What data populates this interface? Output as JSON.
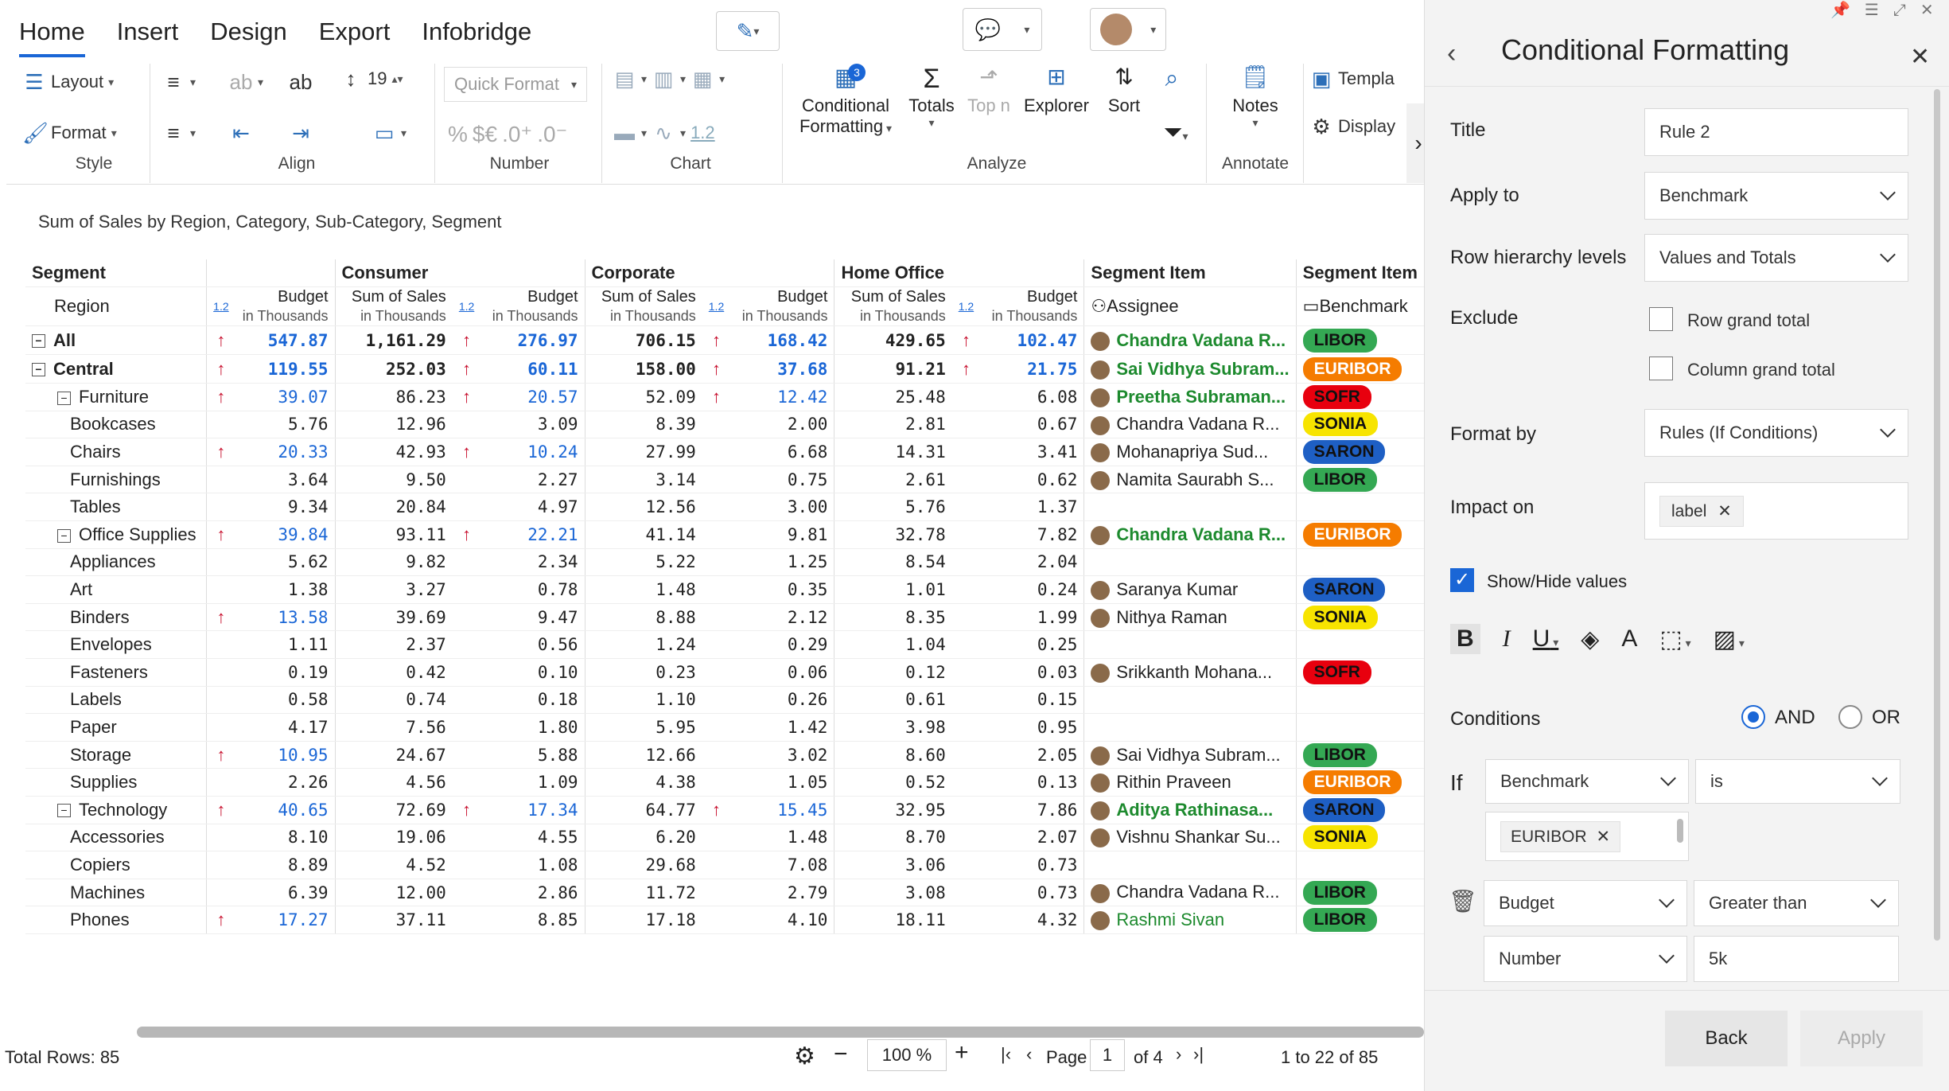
{
  "tabs": [
    "Home",
    "Insert",
    "Design",
    "Export",
    "Infobridge"
  ],
  "ribbon": {
    "layout": "Layout",
    "format": "Format",
    "style": "Style",
    "align": "Align",
    "font_size": "19",
    "quick_format": "Quick Format",
    "number": "Number",
    "number_sym_pct": "%",
    "number_sym_cur": "$€",
    "chart": "Chart",
    "chart_num": "1.2",
    "conditional": "Conditional",
    "formatting": "Formatting",
    "cond_count": "3",
    "totals": "Totals",
    "topn": "Top n",
    "explorer": "Explorer",
    "sort": "Sort",
    "analyze": "Analyze",
    "notes": "Notes",
    "annotate": "Annotate",
    "template": "Templa",
    "display": "Display"
  },
  "report_title": "Sum of Sales by Region, Category, Sub-Category, Segment",
  "headers": {
    "segment": "Segment",
    "region": "Region",
    "consumer": "Consumer",
    "corporate": "Corporate",
    "home_office": "Home Office",
    "segment_item": "Segment Item",
    "budget": "Budget",
    "sum_sales": "Sum of Sales",
    "in_thousands": "in Thousands",
    "assignee": "Assignee",
    "benchmark": "Benchmark",
    "num_icon": "1.2"
  },
  "rows": [
    {
      "label": "All",
      "level": 0,
      "exp": true,
      "bold": true,
      "a1": true,
      "c1": "547.87",
      "c2": "1,161.29",
      "a2": true,
      "c3": "276.97",
      "c4": "706.15",
      "a3": true,
      "c5": "168.42",
      "c6": "429.65",
      "a4": true,
      "c7": "102.47",
      "assignee": "Chandra Vadana R...",
      "astyle": "green",
      "pill": "LIBOR"
    },
    {
      "label": "Central",
      "level": 0,
      "exp": true,
      "bold": true,
      "a1": true,
      "c1": "119.55",
      "c2": "252.03",
      "a2": true,
      "c3": "60.11",
      "c4": "158.00",
      "a3": true,
      "c5": "37.68",
      "c6": "91.21",
      "a4": true,
      "c7": "21.75",
      "assignee": "Sai Vidhya Subram...",
      "astyle": "green",
      "pill": "EURIBOR"
    },
    {
      "label": "Furniture",
      "level": 1,
      "exp": true,
      "bold": false,
      "a1": true,
      "c1": "39.07",
      "c2": "86.23",
      "a2": true,
      "c3": "20.57",
      "c4": "52.09",
      "a3": true,
      "c5": "12.42",
      "c6": "25.48",
      "a4": false,
      "c7": "6.08",
      "assignee": "Preetha Subraman...",
      "astyle": "green",
      "pill": "SOFR"
    },
    {
      "label": "Bookcases",
      "level": 2,
      "a1": false,
      "c1": "5.76",
      "c2": "12.96",
      "a2": false,
      "c3": "3.09",
      "c4": "8.39",
      "a3": false,
      "c5": "2.00",
      "c6": "2.81",
      "a4": false,
      "c7": "0.67",
      "assignee": "Chandra Vadana R...",
      "astyle": "",
      "pill": "SONIA"
    },
    {
      "label": "Chairs",
      "level": 2,
      "a1": true,
      "c1": "20.33",
      "c2": "42.93",
      "a2": true,
      "c3": "10.24",
      "c4": "27.99",
      "a3": false,
      "c5": "6.68",
      "c6": "14.31",
      "a4": false,
      "c7": "3.41",
      "assignee": "Mohanapriya Sud...",
      "astyle": "",
      "pill": "SARON"
    },
    {
      "label": "Furnishings",
      "level": 2,
      "a1": false,
      "c1": "3.64",
      "c2": "9.50",
      "a2": false,
      "c3": "2.27",
      "c4": "3.14",
      "a3": false,
      "c5": "0.75",
      "c6": "2.61",
      "a4": false,
      "c7": "0.62",
      "assignee": "Namita Saurabh S...",
      "astyle": "",
      "pill": "LIBOR"
    },
    {
      "label": "Tables",
      "level": 2,
      "a1": false,
      "c1": "9.34",
      "c2": "20.84",
      "a2": false,
      "c3": "4.97",
      "c4": "12.56",
      "a3": false,
      "c5": "3.00",
      "c6": "5.76",
      "a4": false,
      "c7": "1.37",
      "assignee": "",
      "astyle": "",
      "pill": ""
    },
    {
      "label": "Office Supplies",
      "level": 1,
      "exp": true,
      "bold": false,
      "a1": true,
      "c1": "39.84",
      "c2": "93.11",
      "a2": true,
      "c3": "22.21",
      "c4": "41.14",
      "a3": false,
      "c5": "9.81",
      "c6": "32.78",
      "a4": false,
      "c7": "7.82",
      "assignee": "Chandra Vadana R...",
      "astyle": "green",
      "pill": "EURIBOR"
    },
    {
      "label": "Appliances",
      "level": 2,
      "a1": false,
      "c1": "5.62",
      "c2": "9.82",
      "a2": false,
      "c3": "2.34",
      "c4": "5.22",
      "a3": false,
      "c5": "1.25",
      "c6": "8.54",
      "a4": false,
      "c7": "2.04",
      "assignee": "",
      "astyle": "",
      "pill": ""
    },
    {
      "label": "Art",
      "level": 2,
      "a1": false,
      "c1": "1.38",
      "c2": "3.27",
      "a2": false,
      "c3": "0.78",
      "c4": "1.48",
      "a3": false,
      "c5": "0.35",
      "c6": "1.01",
      "a4": false,
      "c7": "0.24",
      "assignee": "Saranya Kumar",
      "astyle": "",
      "pill": "SARON"
    },
    {
      "label": "Binders",
      "level": 2,
      "a1": true,
      "c1": "13.58",
      "c2": "39.69",
      "a2": false,
      "c3": "9.47",
      "c4": "8.88",
      "a3": false,
      "c5": "2.12",
      "c6": "8.35",
      "a4": false,
      "c7": "1.99",
      "assignee": "Nithya Raman",
      "astyle": "",
      "pill": "SONIA"
    },
    {
      "label": "Envelopes",
      "level": 2,
      "a1": false,
      "c1": "1.11",
      "c2": "2.37",
      "a2": false,
      "c3": "0.56",
      "c4": "1.24",
      "a3": false,
      "c5": "0.29",
      "c6": "1.04",
      "a4": false,
      "c7": "0.25",
      "assignee": "",
      "astyle": "",
      "pill": ""
    },
    {
      "label": "Fasteners",
      "level": 2,
      "a1": false,
      "c1": "0.19",
      "c2": "0.42",
      "a2": false,
      "c3": "0.10",
      "c4": "0.23",
      "a3": false,
      "c5": "0.06",
      "c6": "0.12",
      "a4": false,
      "c7": "0.03",
      "assignee": "Srikkanth Mohana...",
      "astyle": "",
      "pill": "SOFR"
    },
    {
      "label": "Labels",
      "level": 2,
      "a1": false,
      "c1": "0.58",
      "c2": "0.74",
      "a2": false,
      "c3": "0.18",
      "c4": "1.10",
      "a3": false,
      "c5": "0.26",
      "c6": "0.61",
      "a4": false,
      "c7": "0.15",
      "assignee": "",
      "astyle": "",
      "pill": ""
    },
    {
      "label": "Paper",
      "level": 2,
      "a1": false,
      "c1": "4.17",
      "c2": "7.56",
      "a2": false,
      "c3": "1.80",
      "c4": "5.95",
      "a3": false,
      "c5": "1.42",
      "c6": "3.98",
      "a4": false,
      "c7": "0.95",
      "assignee": "",
      "astyle": "",
      "pill": ""
    },
    {
      "label": "Storage",
      "level": 2,
      "a1": true,
      "c1": "10.95",
      "c2": "24.67",
      "a2": false,
      "c3": "5.88",
      "c4": "12.66",
      "a3": false,
      "c5": "3.02",
      "c6": "8.60",
      "a4": false,
      "c7": "2.05",
      "assignee": "Sai Vidhya Subram...",
      "astyle": "",
      "pill": "LIBOR"
    },
    {
      "label": "Supplies",
      "level": 2,
      "a1": false,
      "c1": "2.26",
      "c2": "4.56",
      "a2": false,
      "c3": "1.09",
      "c4": "4.38",
      "a3": false,
      "c5": "1.05",
      "c6": "0.52",
      "a4": false,
      "c7": "0.13",
      "assignee": "Rithin Praveen",
      "astyle": "",
      "pill": "EURIBOR"
    },
    {
      "label": "Technology",
      "level": 1,
      "exp": true,
      "bold": false,
      "a1": true,
      "c1": "40.65",
      "c2": "72.69",
      "a2": true,
      "c3": "17.34",
      "c4": "64.77",
      "a3": true,
      "c5": "15.45",
      "c6": "32.95",
      "a4": false,
      "c7": "7.86",
      "assignee": "Aditya Rathinasa...",
      "astyle": "green",
      "pill": "SARON"
    },
    {
      "label": "Accessories",
      "level": 2,
      "a1": false,
      "c1": "8.10",
      "c2": "19.06",
      "a2": false,
      "c3": "4.55",
      "c4": "6.20",
      "a3": false,
      "c5": "1.48",
      "c6": "8.70",
      "a4": false,
      "c7": "2.07",
      "assignee": "Vishnu Shankar Su...",
      "astyle": "",
      "pill": "SONIA"
    },
    {
      "label": "Copiers",
      "level": 2,
      "a1": false,
      "c1": "8.89",
      "c2": "4.52",
      "a2": false,
      "c3": "1.08",
      "c4": "29.68",
      "a3": false,
      "c5": "7.08",
      "c6": "3.06",
      "a4": false,
      "c7": "0.73",
      "assignee": "",
      "astyle": "",
      "pill": ""
    },
    {
      "label": "Machines",
      "level": 2,
      "a1": false,
      "c1": "6.39",
      "c2": "12.00",
      "a2": false,
      "c3": "2.86",
      "c4": "11.72",
      "a3": false,
      "c5": "2.79",
      "c6": "3.08",
      "a4": false,
      "c7": "0.73",
      "assignee": "Chandra Vadana R...",
      "astyle": "",
      "pill": "LIBOR"
    },
    {
      "label": "Phones",
      "level": 2,
      "a1": true,
      "c1": "17.27",
      "c2": "37.11",
      "a2": false,
      "c3": "8.85",
      "c4": "17.18",
      "a3": false,
      "c5": "4.10",
      "c6": "18.11",
      "a4": false,
      "c7": "4.32",
      "assignee": "Rashmi Sivan",
      "astyle": "greenp",
      "pill": "LIBOR"
    }
  ],
  "footer": {
    "total_rows": "Total Rows: 85",
    "zoom": "100 %",
    "page_label": "Page",
    "page_num": "1",
    "of_pages": "of 4",
    "range": "1 to 22 of 85"
  },
  "panel": {
    "title": "Conditional Formatting",
    "title_label": "Title",
    "title_value": "Rule 2",
    "apply_label": "Apply to",
    "apply_value": "Benchmark",
    "row_levels_label": "Row hierarchy levels",
    "row_levels_value": "Values and Totals",
    "exclude_label": "Exclude",
    "exclude_row": "Row grand total",
    "exclude_col": "Column grand total",
    "format_by_label": "Format by",
    "format_by_value": "Rules (If Conditions)",
    "impact_label": "Impact on",
    "impact_chip": "label",
    "show_hide": "Show/Hide values",
    "conditions_label": "Conditions",
    "and": "AND",
    "or": "OR",
    "if_label": "If",
    "cond1_field": "Benchmark",
    "cond1_op": "is",
    "cond1_chip": "EURIBOR",
    "cond2_field": "Budget",
    "cond2_op": "Greater than",
    "cond2_type": "Number",
    "cond2_value": "5k",
    "back": "Back",
    "apply": "Apply"
  },
  "colors": {
    "accent": "#1a66d6",
    "up_arrow": "#c8102e",
    "green_text": "#1d8a2e"
  }
}
